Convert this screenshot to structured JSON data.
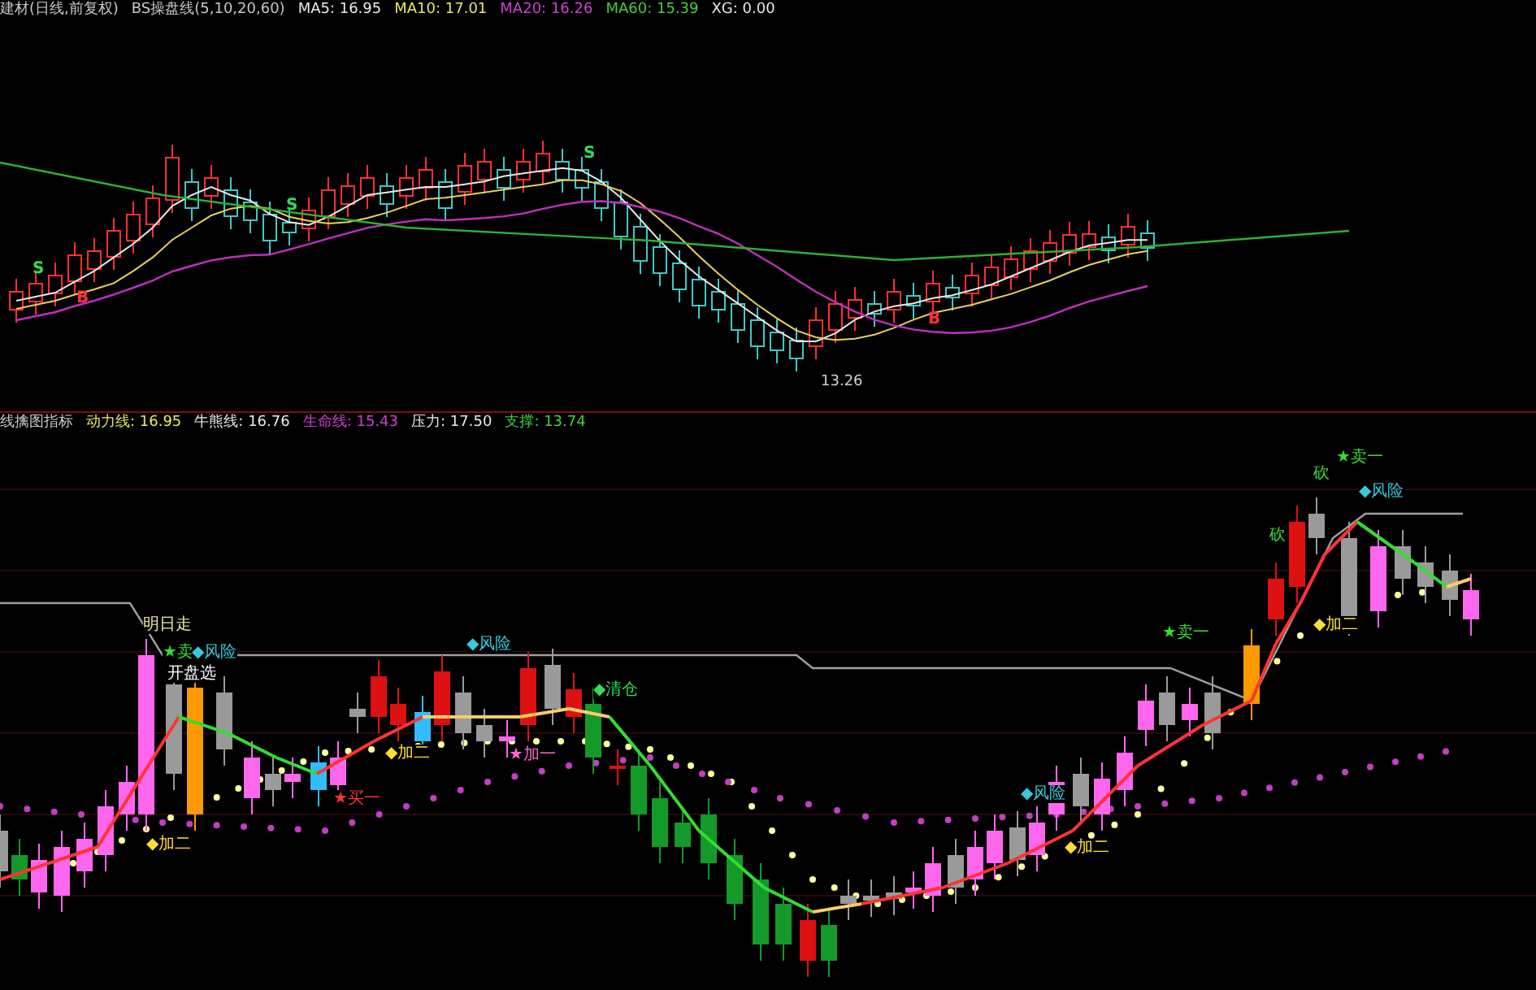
{
  "top_panel": {
    "title": "建材(日线,前复权)",
    "indicator": "BS操盘线(5,10,20,60)",
    "values": [
      {
        "label": "MA5: 16.95",
        "color": "#e8e8e8"
      },
      {
        "label": "MA10: 17.01",
        "color": "#e8e860"
      },
      {
        "label": "MA20: 16.26",
        "color": "#d040d0"
      },
      {
        "label": "MA60: 15.39",
        "color": "#40d040"
      },
      {
        "label": "XG: 0.00",
        "color": "#e8e8e8"
      }
    ],
    "low_label": "13.26",
    "signals": [
      {
        "text": "S",
        "kind": "sell"
      },
      {
        "text": "B",
        "kind": "buy"
      },
      {
        "text": "S",
        "kind": "sell"
      },
      {
        "text": "S",
        "kind": "sell"
      },
      {
        "text": "B",
        "kind": "buy"
      }
    ]
  },
  "bottom_panel": {
    "title": "线擒图指标",
    "values": [
      {
        "label": "动力线: 16.95",
        "color": "#e8e860"
      },
      {
        "label": "牛熊线: 16.76",
        "color": "#e8e8e8"
      },
      {
        "label": "生命线: 15.43",
        "color": "#d040d0"
      },
      {
        "label": "压力: 17.50",
        "color": "#e8e8e8"
      },
      {
        "label": "支撑: 13.74",
        "color": "#40d040"
      }
    ],
    "signals": [
      {
        "text": "明日走",
        "color": "#e8e8a0"
      },
      {
        "text": "★卖",
        "color": "#33dd33"
      },
      {
        "text": "开盘选",
        "color": "#ffffff"
      },
      {
        "text": "◆风险",
        "color": "#33ccdd"
      },
      {
        "text": "◆风险",
        "color": "#33ccdd"
      },
      {
        "text": "◆清仓",
        "color": "#33dd55"
      },
      {
        "text": "◆加二",
        "color": "#ffdd33"
      },
      {
        "text": "★加一",
        "color": "#ff66cc"
      },
      {
        "text": "★买一",
        "color": "#ff3333"
      },
      {
        "text": "◆加二",
        "color": "#ffdd33"
      },
      {
        "text": "◆风险",
        "color": "#33ccdd"
      },
      {
        "text": "◆加二",
        "color": "#ffdd33"
      },
      {
        "text": "★卖一",
        "color": "#33dd33"
      },
      {
        "text": "◆加二",
        "color": "#ffdd33"
      },
      {
        "text": "砍",
        "color": "#33dd33"
      },
      {
        "text": "砍",
        "color": "#33dd33"
      },
      {
        "text": "★卖一",
        "color": "#33dd33"
      },
      {
        "text": "◆风险",
        "color": "#33ccdd"
      }
    ]
  }
}
